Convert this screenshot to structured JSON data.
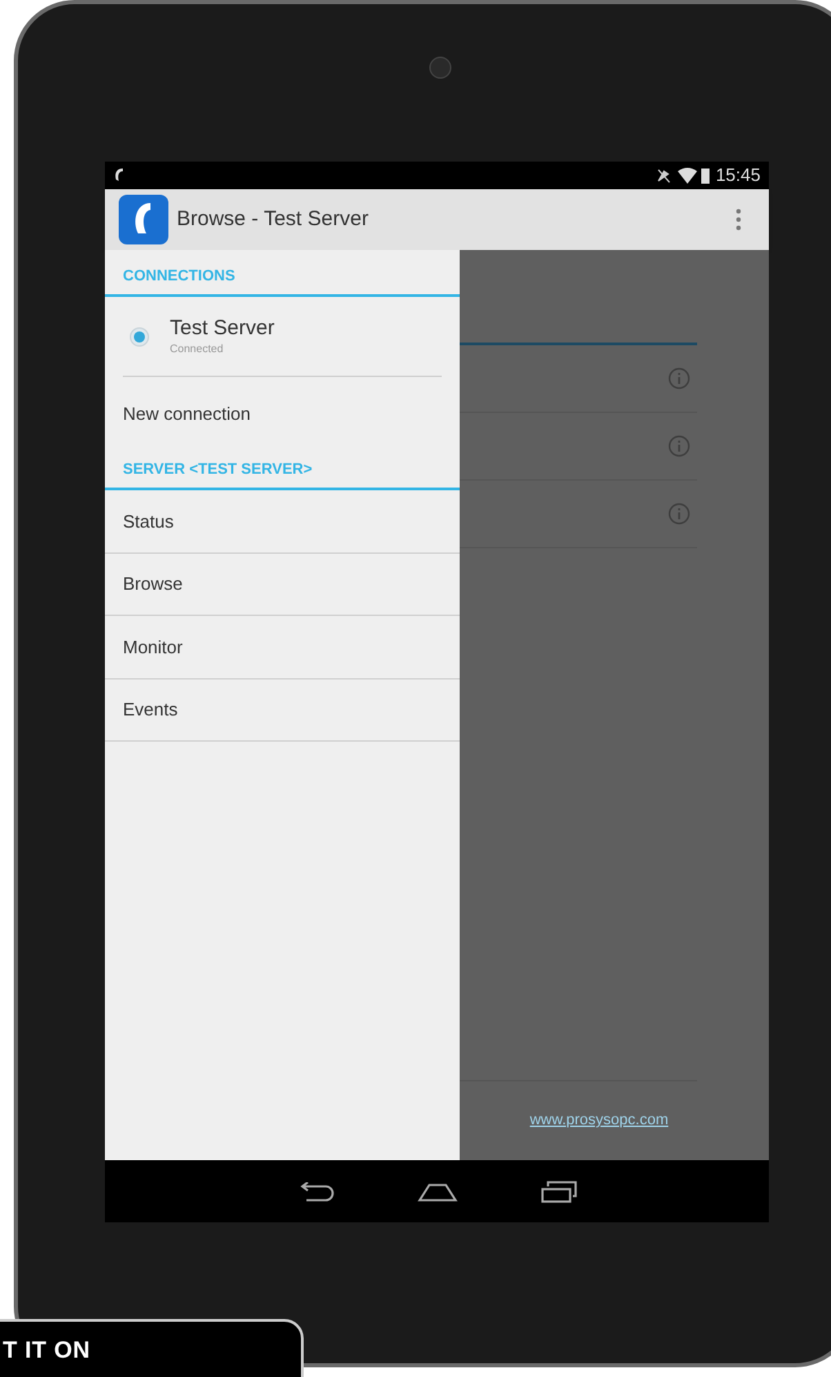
{
  "status_bar": {
    "time": "15:45"
  },
  "action_bar": {
    "title": "Browse - Test Server"
  },
  "drawer": {
    "sections": [
      {
        "header": "CONNECTIONS",
        "items": [
          {
            "kind": "connection",
            "title": "Test Server",
            "subtitle": "Connected",
            "selected": true
          },
          {
            "kind": "action",
            "label": "New connection"
          }
        ]
      },
      {
        "header": "SERVER <TEST SERVER>",
        "items": [
          {
            "kind": "menu",
            "label": "Status"
          },
          {
            "kind": "menu",
            "label": "Browse"
          },
          {
            "kind": "menu",
            "label": "Monitor"
          },
          {
            "kind": "menu",
            "label": "Events"
          }
        ]
      }
    ]
  },
  "background": {
    "footer_link": "www.prosysopc.com"
  },
  "store_badge": {
    "text": "T IT ON"
  }
}
